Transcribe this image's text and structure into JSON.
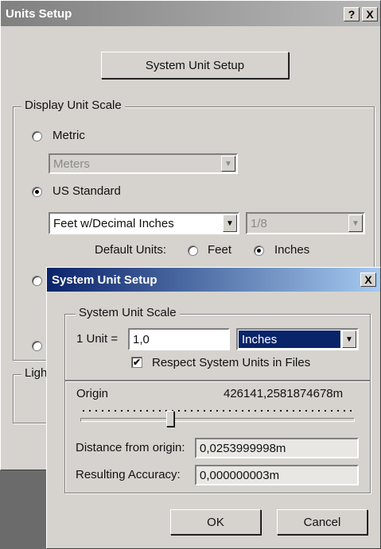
{
  "units_setup": {
    "title": "Units Setup",
    "help_icon": "?",
    "close_icon": "X",
    "system_unit_setup_button": "System Unit Setup",
    "display_unit_scale_label": "Display Unit Scale",
    "metric_label": "Metric",
    "metric_value": "Meters",
    "us_standard_label": "US Standard",
    "us_units_value": "Feet w/Decimal Inches",
    "fraction_value": "1/8",
    "default_units_label": "Default Units:",
    "feet_label": "Feet",
    "inches_label": "Inches",
    "lighting_label_partial": "Ligh",
    "selected_scale": "US Standard",
    "selected_default_unit": "Inches"
  },
  "system_unit_setup": {
    "title": "System Unit Setup",
    "close_icon": "X",
    "scale_group_label": "System Unit Scale",
    "unit_label": "1 Unit =",
    "unit_value": "1,0",
    "unit_type": "Inches",
    "respect_label": "Respect System Units in Files",
    "respect_checked": true,
    "origin_label": "Origin",
    "origin_value": "426141,2581874678m",
    "distance_label": "Distance from origin:",
    "distance_value": "0,0253999998m",
    "accuracy_label": "Resulting Accuracy:",
    "accuracy_value": "0,000000003m",
    "ok_label": "OK",
    "cancel_label": "Cancel"
  },
  "colors": {
    "inactive_title_bar": "#808080",
    "active_title_bar_start": "#0a246a",
    "active_title_bar_end": "#a6caf0",
    "selection_highlight": "#0a246a"
  }
}
